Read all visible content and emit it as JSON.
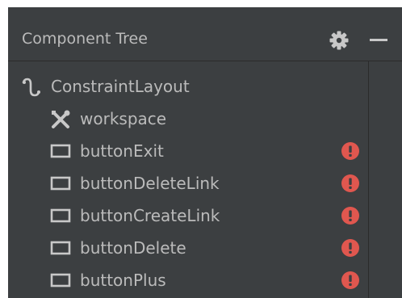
{
  "panel": {
    "title": "Component Tree",
    "icons": {
      "settings": "gear-icon",
      "minimize": "minimize-icon"
    }
  },
  "tree": {
    "root": {
      "label": "ConstraintLayout",
      "icon": "constraint-layout-icon"
    },
    "items": [
      {
        "label": "workspace",
        "icon": "tools-icon",
        "warning": false
      },
      {
        "label": "buttonExit",
        "icon": "button-icon",
        "warning": true
      },
      {
        "label": "buttonDeleteLink",
        "icon": "button-icon",
        "warning": true
      },
      {
        "label": "buttonCreateLink",
        "icon": "button-icon",
        "warning": true
      },
      {
        "label": "buttonDelete",
        "icon": "button-icon",
        "warning": true
      },
      {
        "label": "buttonPlus",
        "icon": "button-icon",
        "warning": true
      }
    ]
  },
  "colors": {
    "panel_bg": "#3c3f41",
    "text": "#bbbbbb",
    "warning": "#e0574f"
  }
}
